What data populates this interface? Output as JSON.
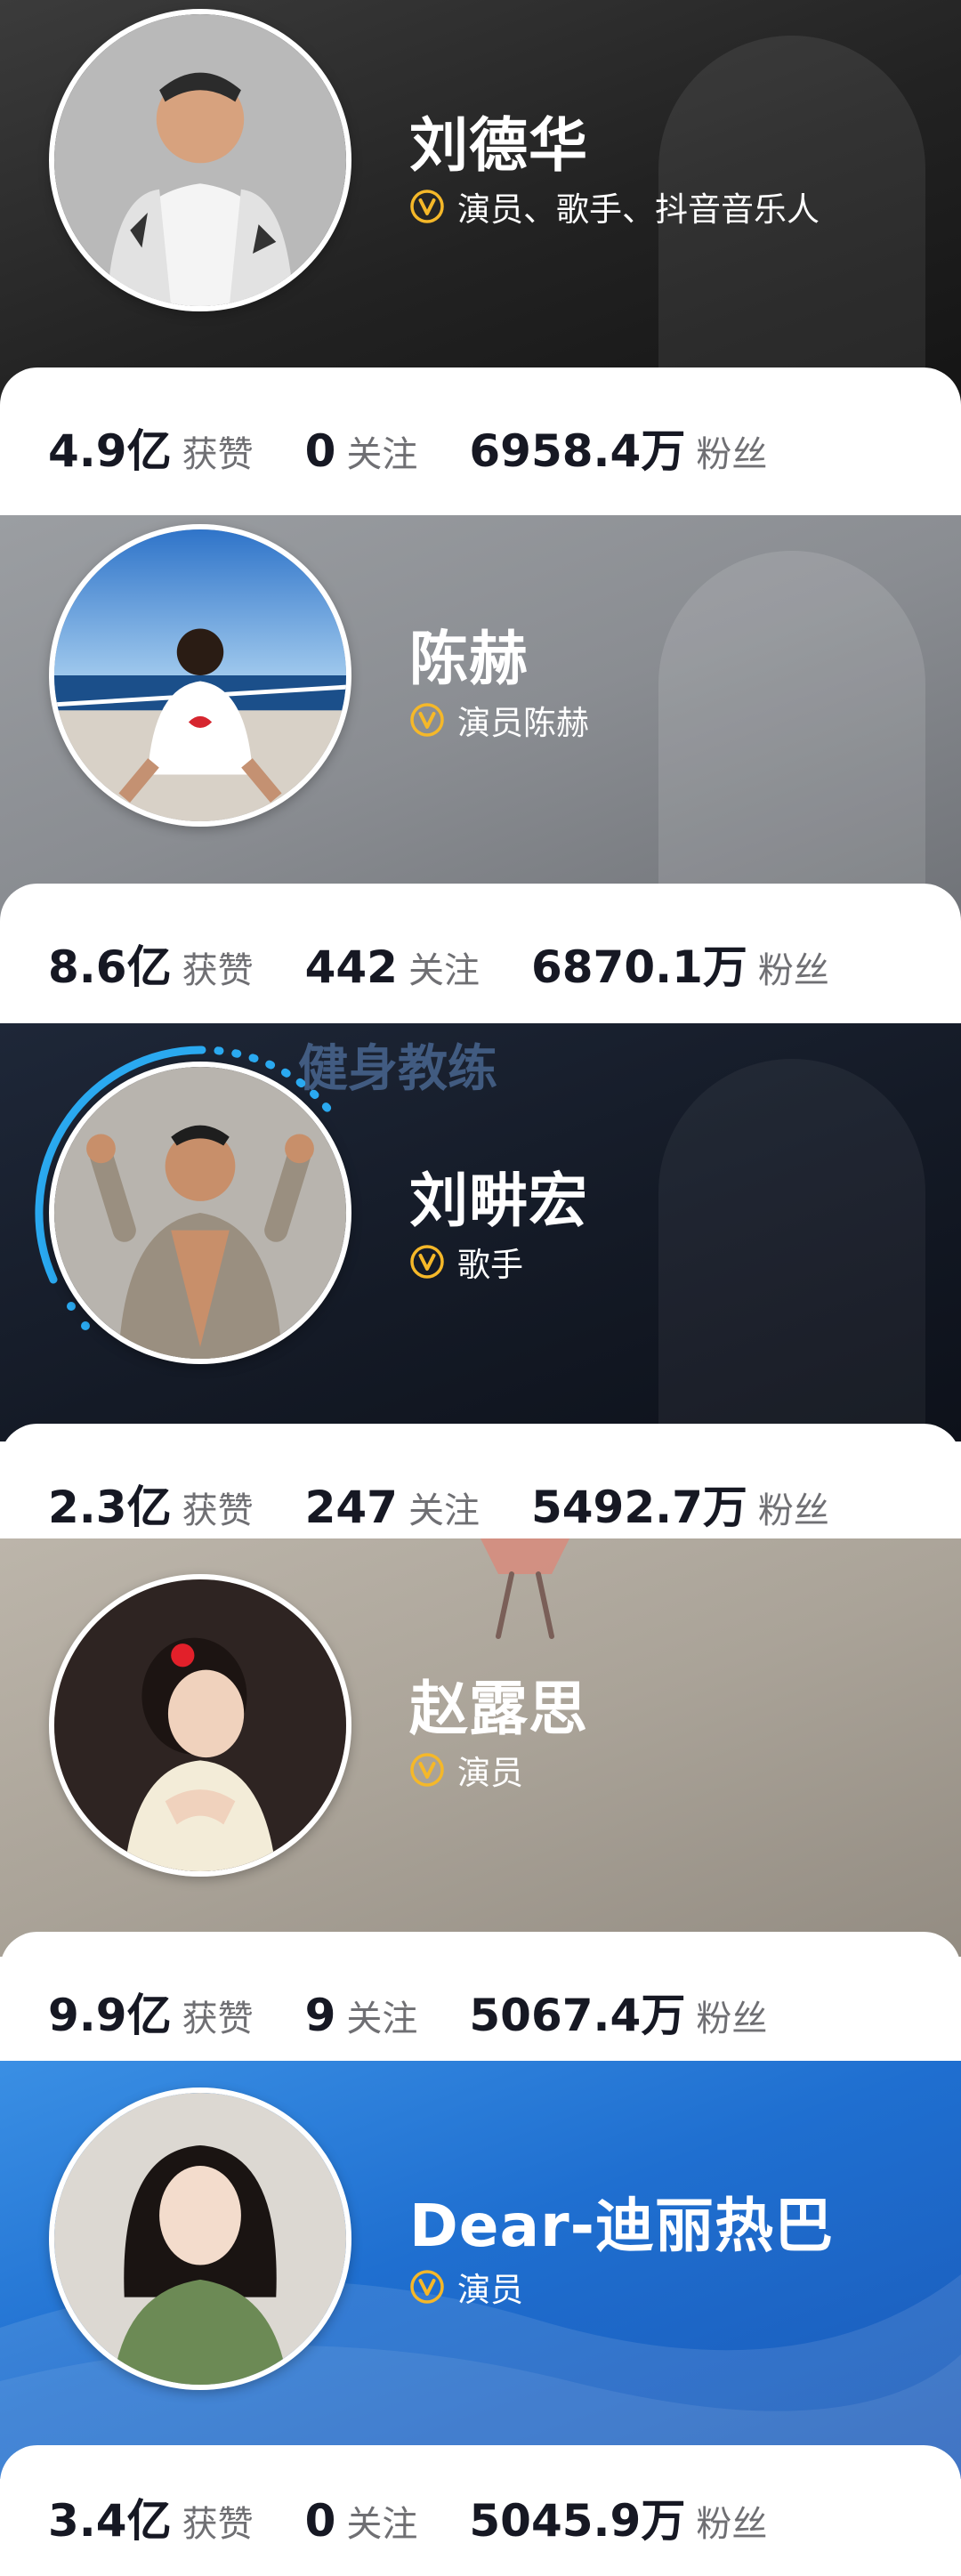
{
  "colors": {
    "verify_badge": "#f5b829",
    "text_dark": "#161823",
    "text_gray": "#6f6f73",
    "live_ring": "#2aa9f0"
  },
  "profiles": [
    {
      "name": "刘德华",
      "verify_text": "演员、歌手、抖音音乐人",
      "likes": "4.9亿",
      "likes_label": "获赞",
      "following": "0",
      "following_label": "关注",
      "followers": "6958.4万",
      "followers_label": "粉丝"
    },
    {
      "name": "陈赫",
      "verify_text": "演员陈赫",
      "likes": "8.6亿",
      "likes_label": "获赞",
      "following": "442",
      "following_label": "关注",
      "followers": "6870.1万",
      "followers_label": "粉丝"
    },
    {
      "name": "刘畊宏",
      "verify_text": "歌手",
      "banner_text": "健身教练",
      "likes": "2.3亿",
      "likes_label": "获赞",
      "following": "247",
      "following_label": "关注",
      "followers": "5492.7万",
      "followers_label": "粉丝"
    },
    {
      "name": "赵露思",
      "verify_text": "演员",
      "likes": "9.9亿",
      "likes_label": "获赞",
      "following": "9",
      "following_label": "关注",
      "followers": "5067.4万",
      "followers_label": "粉丝"
    },
    {
      "name": "Dear-迪丽热巴",
      "verify_text": "演员",
      "likes": "3.4亿",
      "likes_label": "获赞",
      "following": "0",
      "following_label": "关注",
      "followers": "5045.9万",
      "followers_label": "粉丝"
    }
  ]
}
